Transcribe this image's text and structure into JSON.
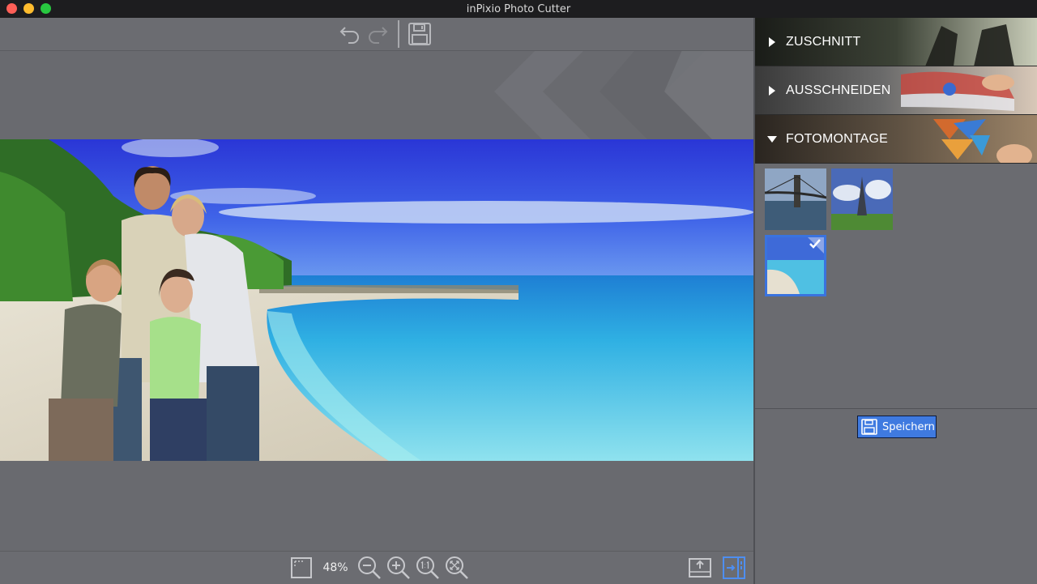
{
  "window": {
    "title": "inPixio Photo Cutter"
  },
  "toolbar": {
    "undo_icon": "undo-arrow-icon",
    "redo_icon": "redo-arrow-icon",
    "save_icon": "floppy-disk-icon"
  },
  "zoom": {
    "level": "48%",
    "icons": [
      "fit-to-screen-icon",
      "zoom-out-icon",
      "zoom-in-icon",
      "zoom-actual-size-icon",
      "zoom-fit-icon"
    ]
  },
  "panel": {
    "sections": [
      {
        "label": "ZUSCHNITT",
        "expanded": false
      },
      {
        "label": "AUSSCHNEIDEN",
        "expanded": false
      },
      {
        "label": "FOTOMONTAGE",
        "expanded": true
      }
    ],
    "backgrounds": [
      {
        "subject": "bridge",
        "selected": false
      },
      {
        "subject": "eiffel-tower",
        "selected": false
      },
      {
        "subject": "beach",
        "selected": true
      }
    ],
    "save_label": "Speichern"
  },
  "colors": {
    "accent": "#3f7ae0",
    "panel_bg": "#6a6b70",
    "canvas_bg": "#696a6f",
    "titlebar_bg": "#1d1d1f"
  }
}
